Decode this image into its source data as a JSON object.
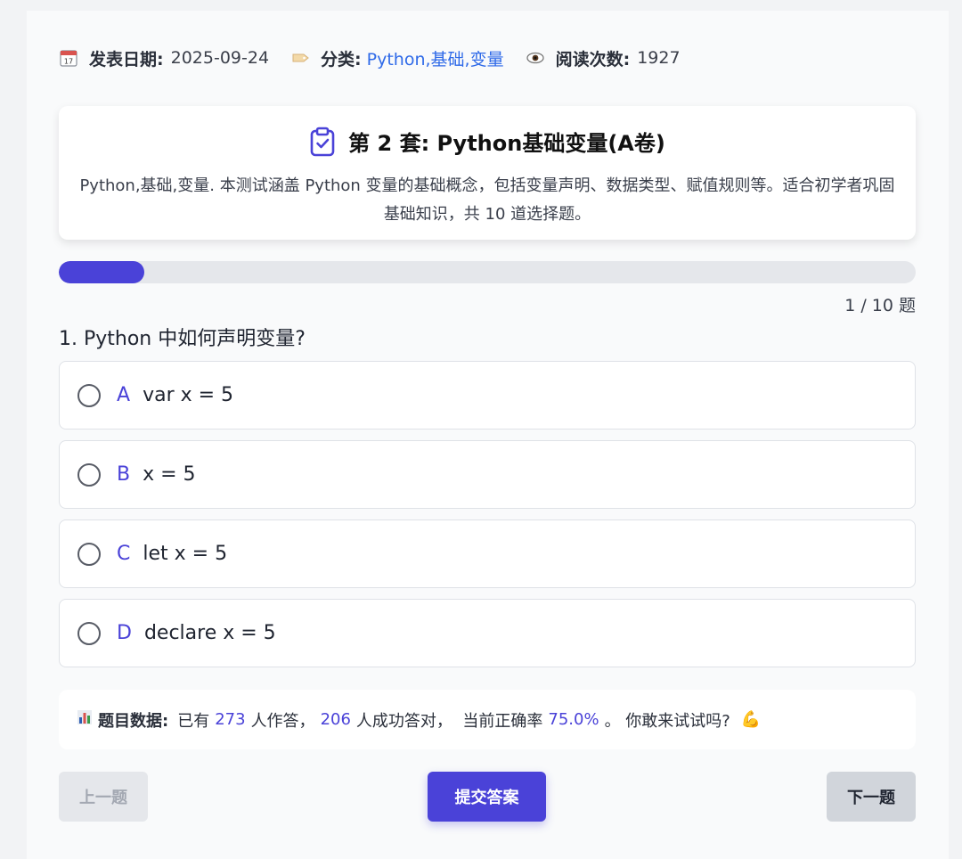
{
  "meta": {
    "date_label": "发表日期:",
    "date_value": "2025-09-24",
    "category_label": "分类:",
    "category_value": "Python,基础,变量",
    "views_label": "阅读次数:",
    "views_value": "1927"
  },
  "header": {
    "title": "第 2 套: Python基础变量(A卷)",
    "description": "Python,基础,变量. 本测试涵盖 Python 变量的基础概念，包括变量声明、数据类型、赋值规则等。适合初学者巩固基础知识，共 10 道选择题。"
  },
  "progress": {
    "current": 1,
    "total": 10,
    "fraction": 0.1,
    "text": "1 / 10 题"
  },
  "question": {
    "text": "1. Python 中如何声明变量?",
    "options": [
      {
        "letter": "A",
        "text": "var x = 5"
      },
      {
        "letter": "B",
        "text": "x = 5"
      },
      {
        "letter": "C",
        "text": "let x = 5"
      },
      {
        "letter": "D",
        "text": "declare x = 5"
      }
    ]
  },
  "stats": {
    "icon": "bar-chart-icon",
    "label": "题目数据:",
    "prefix": "已有",
    "answered": "273",
    "middle": "人作答，",
    "correct": "206",
    "middle2": "人成功答对，  当前正确率",
    "rate": "75.0%",
    "suffix": "。 你敢来试试吗?",
    "emoji": "💪"
  },
  "buttons": {
    "prev": "上一题",
    "submit": "提交答案",
    "next": "下一题"
  },
  "colors": {
    "accent": "#4a42d8",
    "link": "#2f6ae8"
  }
}
